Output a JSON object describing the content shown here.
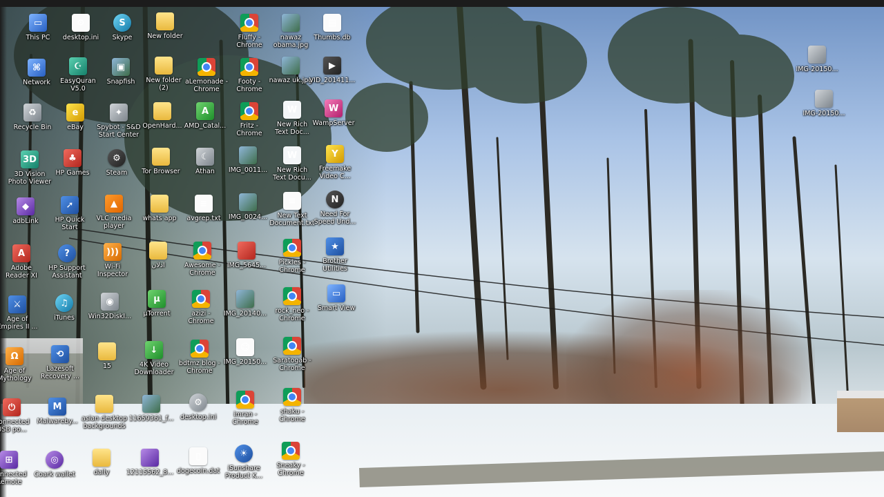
{
  "desktop": {
    "icons": [
      {
        "label": "This PC",
        "icon": "computer-icon"
      },
      {
        "label": "desktop.ini",
        "icon": "settings-file-icon"
      },
      {
        "label": "Skype",
        "icon": "skype-icon"
      },
      {
        "label": "New folder",
        "icon": "folder-icon"
      },
      {
        "label": "Fluffy -\nChrome",
        "icon": "chrome-icon"
      },
      {
        "label": "nawaz\nobama.jpg",
        "icon": "image-file-icon"
      },
      {
        "label": "Thumbs.db",
        "icon": "system-file-icon"
      },
      {
        "label": "Network",
        "icon": "network-icon"
      },
      {
        "label": "EasyQuran\nV5.0",
        "icon": "quran-app-icon"
      },
      {
        "label": "Snapfish",
        "icon": "snapfish-icon"
      },
      {
        "label": "New folder\n(2)",
        "icon": "folder-icon"
      },
      {
        "label": "aLemonade -\nChrome",
        "icon": "chrome-icon"
      },
      {
        "label": "Footy -\nChrome",
        "icon": "chrome-icon"
      },
      {
        "label": "nawaz uk.jpg",
        "icon": "image-file-icon"
      },
      {
        "label": "VID_201411...",
        "icon": "video-file-icon"
      },
      {
        "label": "Recycle Bin",
        "icon": "recycle-bin-icon"
      },
      {
        "label": "eBay",
        "icon": "ebay-icon"
      },
      {
        "label": "Spybot - S&D\nStart Center",
        "icon": "spybot-icon"
      },
      {
        "label": "OpenHard...",
        "icon": "folder-icon"
      },
      {
        "label": "AMD_Catal...",
        "icon": "amd-icon"
      },
      {
        "label": "Fritz -\nChrome",
        "icon": "chrome-icon"
      },
      {
        "label": "New Rich\nText Doc...",
        "icon": "word-doc-icon"
      },
      {
        "label": "WampServer",
        "icon": "wampserver-icon"
      },
      {
        "label": "3D Vision\nPhoto Viewer",
        "icon": "3d-vision-icon"
      },
      {
        "label": "HP Games",
        "icon": "hp-games-icon"
      },
      {
        "label": "Steam",
        "icon": "steam-icon"
      },
      {
        "label": "Tor Browser",
        "icon": "folder-icon"
      },
      {
        "label": "Athan",
        "icon": "athan-icon"
      },
      {
        "label": "IMG_0011...",
        "icon": "image-file-icon"
      },
      {
        "label": "New Rich\nText Docu...",
        "icon": "word-doc-icon"
      },
      {
        "label": "Freemake\nVideo C...",
        "icon": "freemake-icon"
      },
      {
        "label": "adbLink",
        "icon": "adblink-icon"
      },
      {
        "label": "HP Quick\nStart",
        "icon": "hp-quickstart-icon"
      },
      {
        "label": "VLC media\nplayer",
        "icon": "vlc-icon"
      },
      {
        "label": "whats app",
        "icon": "folder-icon"
      },
      {
        "label": "avgrep.txt",
        "icon": "text-file-icon"
      },
      {
        "label": "IMG_0024...",
        "icon": "image-file-icon"
      },
      {
        "label": "New Text\nDocument.txt",
        "icon": "text-file-icon"
      },
      {
        "label": "Need For\nSpeed Und...",
        "icon": "nfs-icon"
      },
      {
        "label": "Adobe\nReader XI",
        "icon": "adobe-reader-icon"
      },
      {
        "label": "HP Support\nAssistant",
        "icon": "hp-support-icon"
      },
      {
        "label": "Wi-Fi\nInspector",
        "icon": "wifi-icon"
      },
      {
        "label": "ادلان",
        "icon": "folder-icon"
      },
      {
        "label": "Awesome -\nChrome",
        "icon": "chrome-icon"
      },
      {
        "label": "IMG_5645...",
        "icon": "image-file-icon"
      },
      {
        "label": "Pickles -\nChrome",
        "icon": "chrome-icon"
      },
      {
        "label": "Brother\nUtilities",
        "icon": "brother-icon"
      },
      {
        "label": "Age of\nEmpires II ...",
        "icon": "aoe-icon"
      },
      {
        "label": "iTunes",
        "icon": "itunes-icon"
      },
      {
        "label": "Win32DiskI...",
        "icon": "disk-imager-icon"
      },
      {
        "label": "µTorrent",
        "icon": "utorrent-icon"
      },
      {
        "label": "azizi -\nChrome",
        "icon": "chrome-icon"
      },
      {
        "label": "IMG_20140...",
        "icon": "image-file-icon"
      },
      {
        "label": "rock_neo -\nChrome",
        "icon": "chrome-icon"
      },
      {
        "label": "Smart View",
        "icon": "smart-view-icon"
      },
      {
        "label": "Age of\nMythology",
        "icon": "aom-icon"
      },
      {
        "label": "Lazesoft\nRecovery ...",
        "icon": "lazesoft-icon"
      },
      {
        "label": "15",
        "icon": "folder-icon"
      },
      {
        "label": "4K Video\nDownloader",
        "icon": "4k-video-icon"
      },
      {
        "label": "bdtmz blog -\nChrome",
        "icon": "chrome-icon"
      },
      {
        "label": "IMG_20150...",
        "icon": "image-file-icon"
      },
      {
        "label": "Saratogab -\nChrome",
        "icon": "chrome-icon"
      },
      {
        "label": "Connected\nUSB po...",
        "icon": "usb-icon"
      },
      {
        "label": "Malwareby...",
        "icon": "malwarebytes-icon"
      },
      {
        "label": "asian desktop\nbackgrounds",
        "icon": "folder-icon"
      },
      {
        "label": "11659361_f...",
        "icon": "image-file-icon"
      },
      {
        "label": "desktop.ini",
        "icon": "settings-file-icon"
      },
      {
        "label": "imran -\nChrome",
        "icon": "chrome-icon"
      },
      {
        "label": "shaku -\nChrome",
        "icon": "chrome-icon"
      },
      {
        "label": "Connected\nRemote",
        "icon": "remote-icon"
      },
      {
        "label": "Coark wallet",
        "icon": "wallet-icon"
      },
      {
        "label": "daily",
        "icon": "folder-icon"
      },
      {
        "label": "12115562_8...",
        "icon": "image-file-icon"
      },
      {
        "label": "dogecoin.dat",
        "icon": "dat-file-icon"
      },
      {
        "label": "iSunshare\nProduct K...",
        "icon": "isunshare-icon"
      },
      {
        "label": "Sneaky -\nChrome",
        "icon": "chrome-icon"
      },
      {
        "label": "IMG-20150...",
        "icon": "image-file-icon"
      },
      {
        "label": "IMG-20150...",
        "icon": "image-file-icon"
      }
    ]
  },
  "colors": {
    "icon_text": "#ffffff",
    "sky": "#a9c3e6",
    "snow": "#f1f4f6",
    "brush": "#7a4a30"
  }
}
